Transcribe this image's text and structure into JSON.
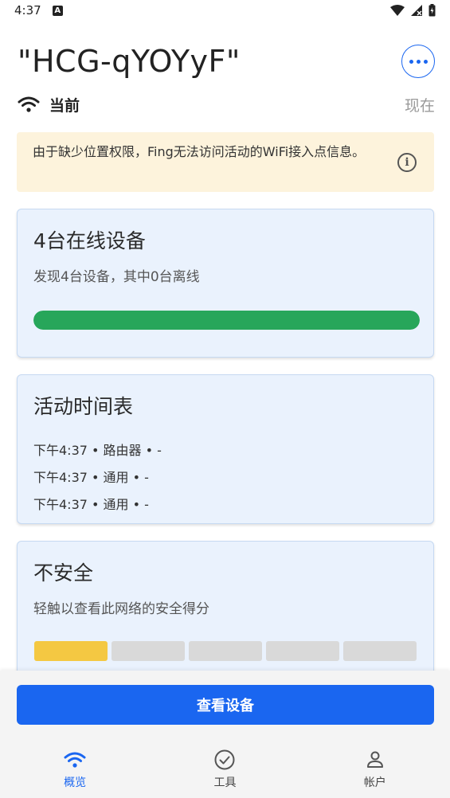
{
  "status_bar": {
    "time": "4:37",
    "badge": "A"
  },
  "header": {
    "network_name": "\"HCG-qYOYyF\""
  },
  "subheader": {
    "label": "当前",
    "time": "现在"
  },
  "notice": {
    "text": "由于缺少位置权限，Fing无法访问活动的WiFi接入点信息。",
    "info_glyph": "i"
  },
  "devices_card": {
    "title": "4台在线设备",
    "subtitle": "发现4台设备，其中0台离线",
    "online_fraction": 1.0
  },
  "timeline_card": {
    "title": "活动时间表",
    "items": [
      "下午4:37 • 路由器 • -",
      "下午4:37 • 通用 • -",
      "下午4:37 • 通用 • -"
    ]
  },
  "security_card": {
    "title": "不安全",
    "subtitle": "轻触以查看此网络的安全得分",
    "score_segments_total": 5,
    "score_segments_filled": 1
  },
  "primary_action": {
    "label": "查看设备"
  },
  "bottom_nav": {
    "items": [
      {
        "label": "概览",
        "icon": "wifi-icon",
        "active": true
      },
      {
        "label": "工具",
        "icon": "check-circle-icon",
        "active": false
      },
      {
        "label": "帐户",
        "icon": "person-icon",
        "active": false
      }
    ]
  },
  "colors": {
    "accent": "#1a66f0",
    "success": "#27a65a",
    "warning": "#f4c842",
    "notice_bg": "#fdf3dc",
    "card_bg": "#eaf2fd"
  }
}
